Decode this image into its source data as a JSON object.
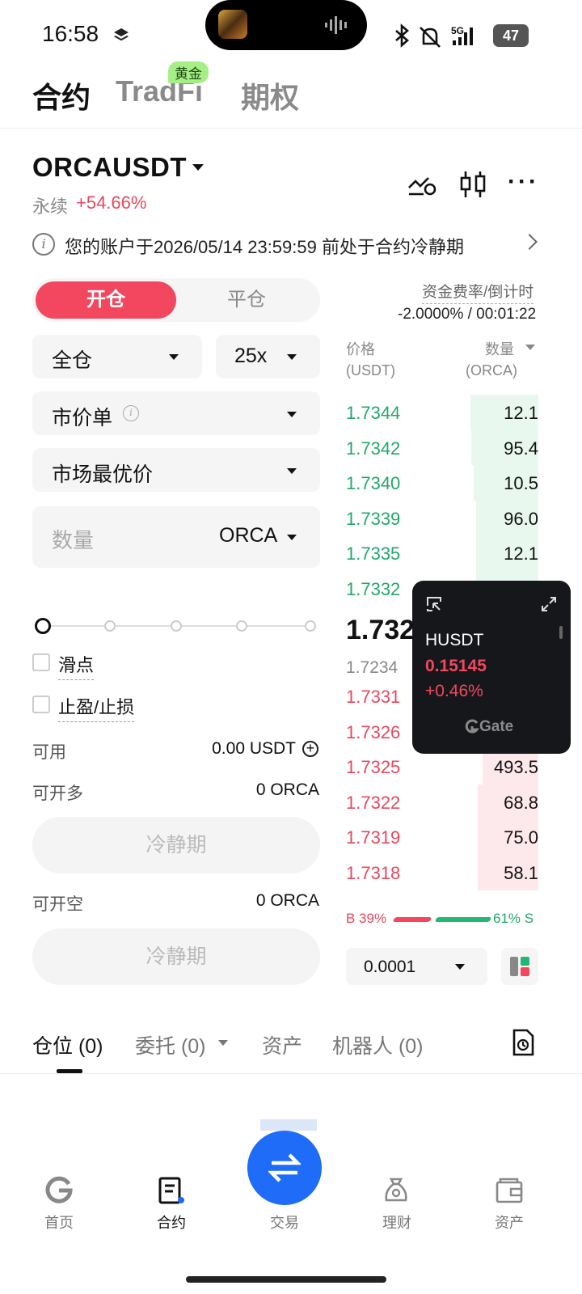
{
  "status_bar": {
    "time": "16:58",
    "battery": "47",
    "network": "5G"
  },
  "top_tabs": {
    "contracts": "合约",
    "tradfi": "TradFi",
    "gold_badge": "黄金",
    "options": "期权"
  },
  "symbol": {
    "name": "ORCAUSDT",
    "type": "永续",
    "change": "+54.66%"
  },
  "notice": {
    "text": "您的账户于2026/05/14 23:59:59 前处于合约冷静期"
  },
  "order_form": {
    "open_label": "开仓",
    "close_label": "平仓",
    "margin_mode": "全仓",
    "leverage": "25x",
    "order_type": "市价单",
    "price_type": "市场最优价",
    "quantity_placeholder": "数量",
    "quantity_unit": "ORCA",
    "slider_percent": 0,
    "slippage_label": "滑点",
    "tpsl_label": "止盈/止损",
    "available_label": "可用",
    "available_value": "0.00 USDT",
    "max_long_label": "可开多",
    "max_long_value": "0 ORCA",
    "long_button": "冷静期",
    "max_short_label": "可开空",
    "max_short_value": "0 ORCA",
    "short_button": "冷静期"
  },
  "funding": {
    "label": "资金费率/倒计时",
    "value": "-2.0000% / 00:01:22"
  },
  "order_book": {
    "price_header": "价格",
    "price_unit": "(USDT)",
    "qty_header": "数量",
    "qty_unit": "(ORCA)",
    "asks": [
      {
        "price": "1.7344",
        "qty": "12.1",
        "depth": 0.98
      },
      {
        "price": "1.7342",
        "qty": "95.4",
        "depth": 0.97
      },
      {
        "price": "1.7340",
        "qty": "10.5",
        "depth": 0.93
      },
      {
        "price": "1.7339",
        "qty": "96.0",
        "depth": 0.89
      },
      {
        "price": "1.7335",
        "qty": "12.1",
        "depth": 0.89
      },
      {
        "price": "1.7332",
        "qty": "",
        "depth": 0.89
      }
    ],
    "last_price": "1.732",
    "mark_price": "1.7234",
    "bids": [
      {
        "price": "1.7331",
        "qty": "",
        "depth": 0.9
      },
      {
        "price": "1.7326",
        "qty": "",
        "depth": 0.9
      },
      {
        "price": "1.7325",
        "qty": "493.5",
        "depth": 0.8
      },
      {
        "price": "1.7322",
        "qty": "68.8",
        "depth": 0.87
      },
      {
        "price": "1.7319",
        "qty": "75.0",
        "depth": 0.87
      },
      {
        "price": "1.7318",
        "qty": "58.1",
        "depth": 0.87
      }
    ],
    "buy_ratio_label": "B 39%",
    "sell_ratio_label": "61% S",
    "buy_ratio": 0.39,
    "depth_step": "0.0001"
  },
  "floating_widget": {
    "symbol": "HUSDT",
    "price": "0.15145",
    "change": "+0.46%",
    "brand": "Gate"
  },
  "position_tabs": {
    "positions": "仓位 (0)",
    "orders": "委托 (0)",
    "assets": "资产",
    "bots": "机器人 (0)"
  },
  "bottom_nav": {
    "home": "首页",
    "contracts": "合约",
    "trade": "交易",
    "finance": "理财",
    "assets": "资产"
  },
  "colors": {
    "accent_red": "#f2475e",
    "accent_green": "#22a86a",
    "fab_blue": "#1e6cf7"
  }
}
